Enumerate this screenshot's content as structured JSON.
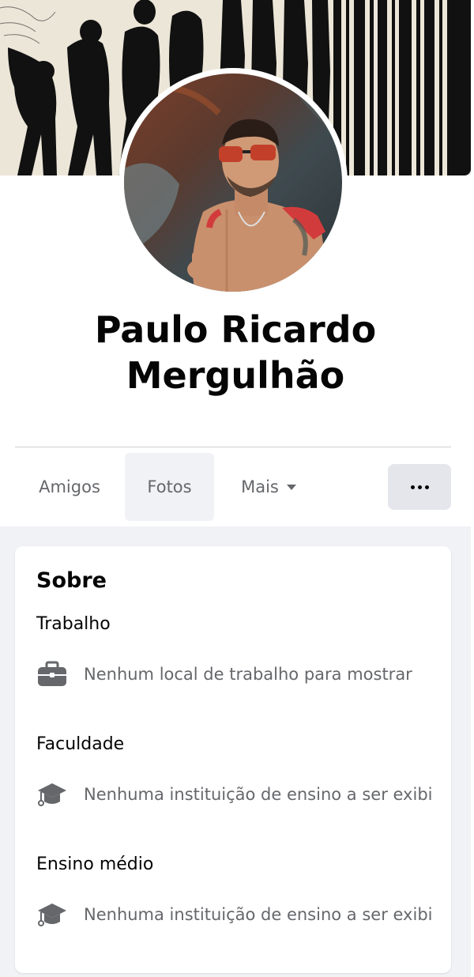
{
  "profile": {
    "name_line1": "Paulo Ricardo",
    "name_line2": "Mergulhão"
  },
  "tabs": [
    {
      "label": "Amigos",
      "active": false
    },
    {
      "label": "Fotos",
      "active": true
    },
    {
      "label": "Mais",
      "active": false
    }
  ],
  "about": {
    "title": "Sobre",
    "sections": [
      {
        "title": "Trabalho",
        "icon": "briefcase-icon",
        "text": "Nenhum local de trabalho para mostrar"
      },
      {
        "title": "Faculdade",
        "icon": "graduation-cap-icon",
        "text": "Nenhuma instituição de ensino a ser exibi"
      },
      {
        "title": "Ensino médio",
        "icon": "graduation-cap-icon",
        "text": "Nenhuma instituição de ensino a ser exibi"
      }
    ]
  },
  "colors": {
    "background": "#f0f2f5",
    "text_primary": "#050505",
    "text_secondary": "#65676b",
    "button_grey": "#e4e6eb"
  }
}
